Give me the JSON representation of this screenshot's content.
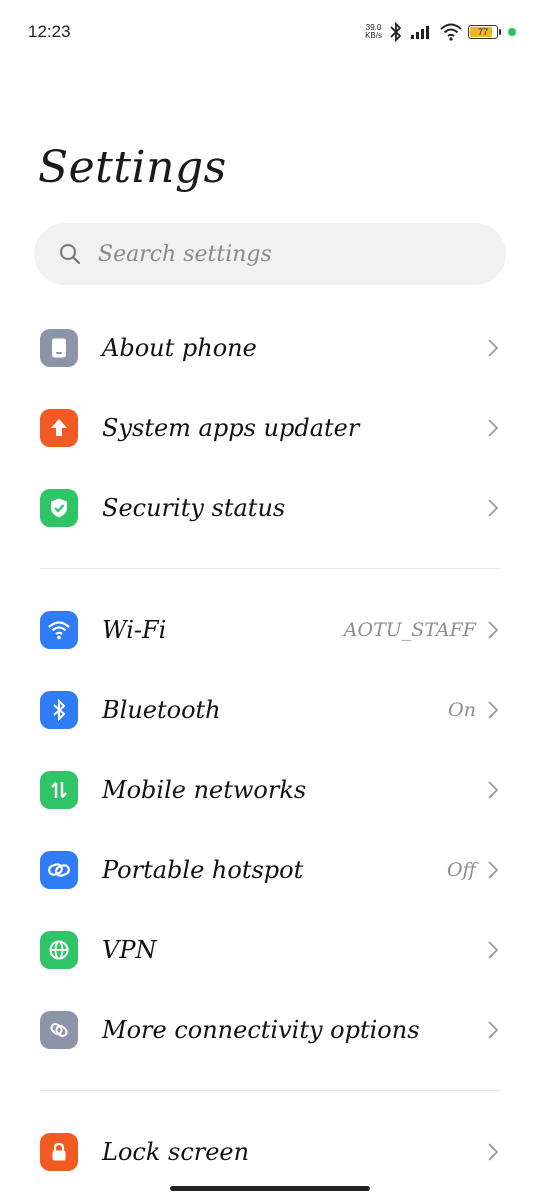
{
  "status_bar": {
    "time": "12:23",
    "net_speed_value": "39.0",
    "net_speed_unit": "KB/s",
    "battery": "77"
  },
  "page": {
    "title": "Settings"
  },
  "search": {
    "placeholder": "Search settings"
  },
  "groups": [
    {
      "items": [
        {
          "label": "About phone",
          "icon": "phone-icon",
          "color": "#8c95a8",
          "value": ""
        },
        {
          "label": "System apps updater",
          "icon": "arrow-up-icon",
          "color": "#f15a22",
          "value": ""
        },
        {
          "label": "Security status",
          "icon": "shield-check-icon",
          "color": "#2fc466",
          "value": ""
        }
      ]
    },
    {
      "items": [
        {
          "label": "Wi-Fi",
          "icon": "wifi-icon",
          "color": "#2f7cf6",
          "value": "AOTU_STAFF"
        },
        {
          "label": "Bluetooth",
          "icon": "bluetooth-icon",
          "color": "#2f7cf6",
          "value": "On"
        },
        {
          "label": "Mobile networks",
          "icon": "mobile-data-icon",
          "color": "#2fc466",
          "value": ""
        },
        {
          "label": "Portable hotspot",
          "icon": "hotspot-link-icon",
          "color": "#2f7cf6",
          "value": "Off"
        },
        {
          "label": "VPN",
          "icon": "globe-icon",
          "color": "#2fc466",
          "value": ""
        },
        {
          "label": "More connectivity options",
          "icon": "connectivity-icon",
          "color": "#8c95a8",
          "value": ""
        }
      ]
    },
    {
      "items": [
        {
          "label": "Lock screen",
          "icon": "lock-icon",
          "color": "#f15a22",
          "value": ""
        }
      ]
    }
  ]
}
